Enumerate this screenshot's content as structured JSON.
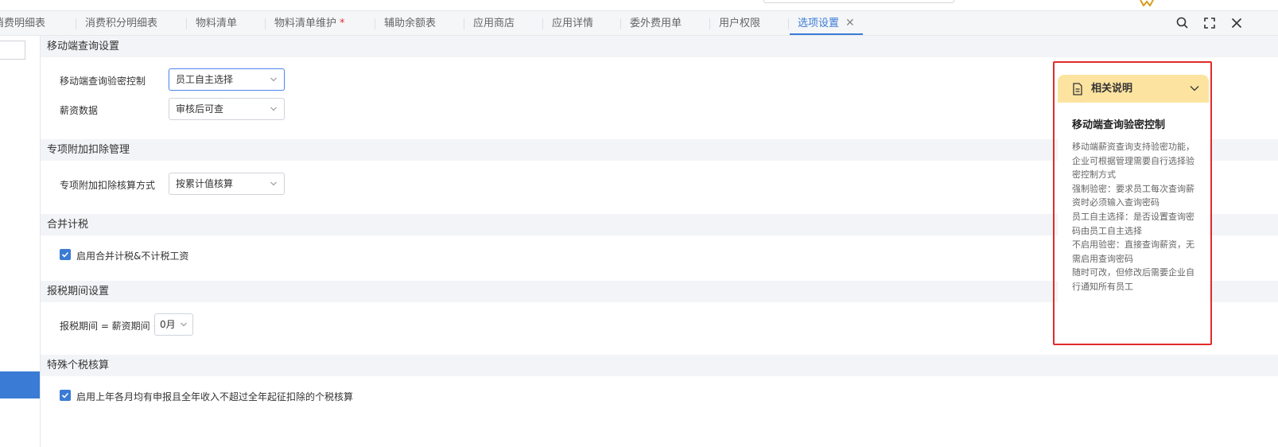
{
  "tabs": [
    {
      "label": "消费明细表"
    },
    {
      "label": "消费积分明细表"
    },
    {
      "label": "物料清单"
    },
    {
      "label": "物料清单维护",
      "modified": "*"
    },
    {
      "label": "辅助余额表"
    },
    {
      "label": "应用商店"
    },
    {
      "label": "应用详情"
    },
    {
      "label": "委外费用单"
    },
    {
      "label": "用户权限"
    },
    {
      "label": "选项设置",
      "close": "✕"
    }
  ],
  "sections": {
    "mobile": {
      "title": "移动端查询设置",
      "verify_label": "移动端查询验密控制",
      "verify_value": "员工自主选择",
      "salary_label": "薪资数据",
      "salary_value": "审核后可查"
    },
    "special": {
      "title": "专项附加扣除管理",
      "calc_label": "专项附加扣除核算方式",
      "calc_value": "按累计值核算"
    },
    "merge": {
      "title": "合并计税",
      "checkbox_label": "启用合并计税&不计税工资"
    },
    "period": {
      "title": "报税期间设置",
      "formula_label": "报税期间 = 薪资期间 +",
      "offset_value": "0月"
    },
    "special_tax": {
      "title": "特殊个税核算",
      "checkbox_label": "启用上年各月均有申报且全年收入不超过全年起征扣除的个税核算"
    }
  },
  "help": {
    "title": "相关说明",
    "topic": "移动端查询验密控制",
    "lines": [
      "移动端薪资查询支持验密功能，企业可根据管理需要自行选择验密控制方式",
      "强制验密：要求员工每次查询薪资时必须输入查询密码",
      "员工自主选择：是否设置查询密码由员工自主选择",
      "不启用验密：直接查询薪资，无需启用查询密码",
      "随时可改，但修改后需要企业自行通知所有员工"
    ]
  },
  "colors": {
    "accent": "#3a7bd5",
    "help_header": "#fce4a0",
    "highlight_outline": "#e02b2b"
  },
  "icons": [
    "search-icon",
    "fullscreen-icon",
    "close-icon",
    "chevron-down-icon",
    "document-icon",
    "checkmark-icon"
  ]
}
